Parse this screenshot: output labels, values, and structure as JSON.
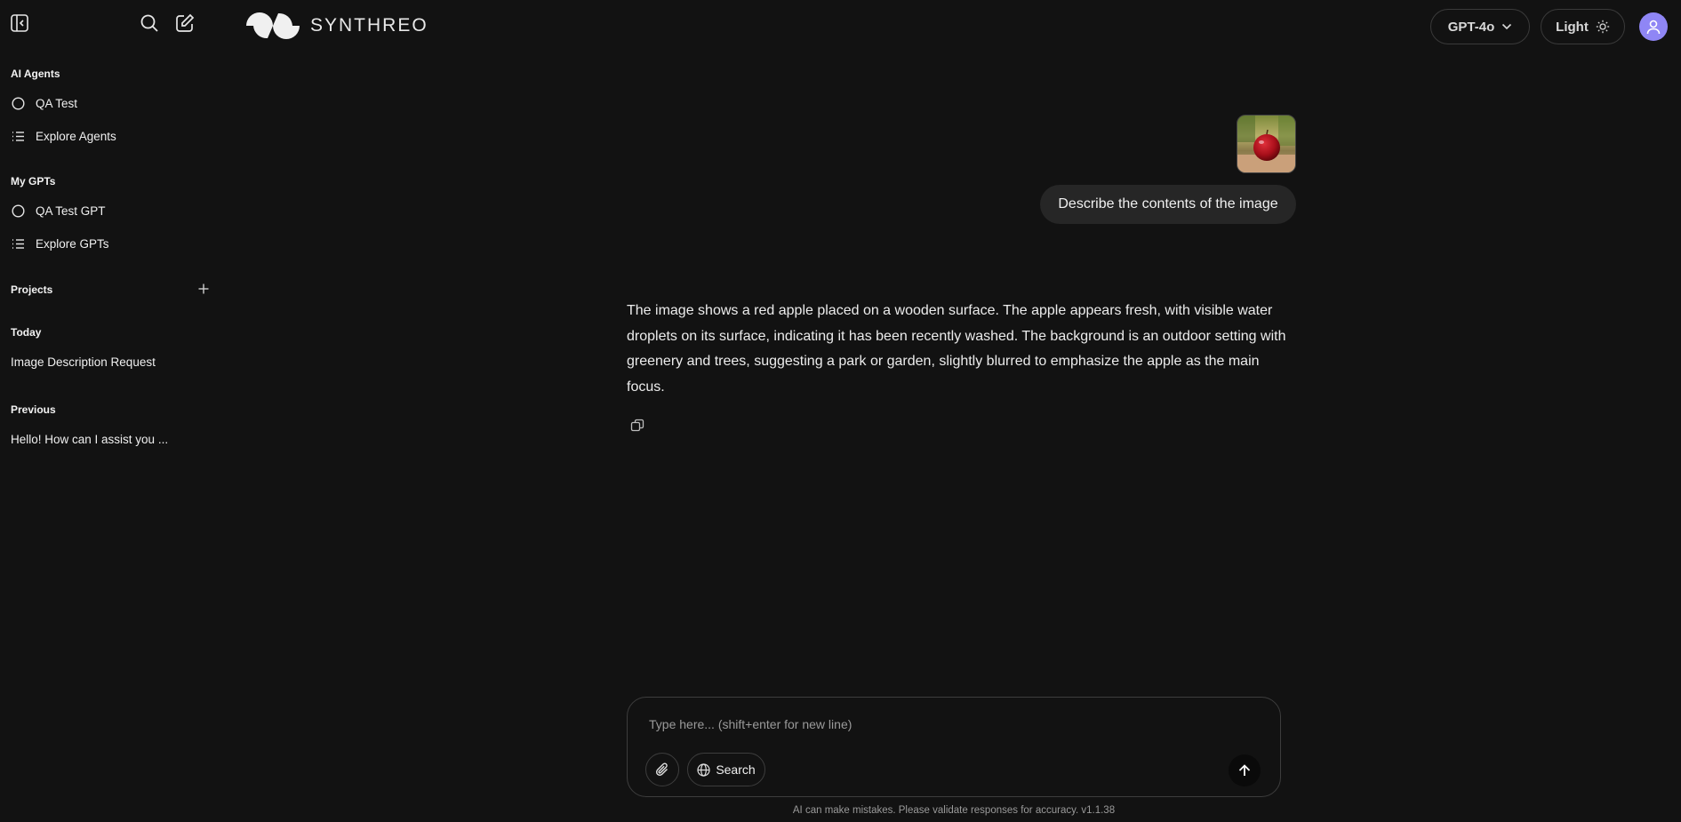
{
  "app": {
    "logo_text": "SYNTHREO"
  },
  "header": {
    "model_label": "GPT-4o",
    "theme_label": "Light"
  },
  "sidebar": {
    "agents": {
      "title": "AI Agents",
      "items": [
        {
          "label": "QA Test"
        },
        {
          "label": "Explore Agents"
        }
      ]
    },
    "gpts": {
      "title": "My GPTs",
      "items": [
        {
          "label": "QA Test GPT"
        },
        {
          "label": "Explore GPTs"
        }
      ]
    },
    "projects": {
      "title": "Projects"
    },
    "today": {
      "title": "Today",
      "items": [
        {
          "label": "Image Description Request"
        }
      ]
    },
    "previous": {
      "title": "Previous",
      "items": [
        {
          "label": "Hello! How can I assist you ..."
        }
      ]
    }
  },
  "chat": {
    "user_message": "Describe the contents of the image",
    "assistant_message": "The image shows a red apple placed on a wooden surface. The apple appears fresh, with visible water droplets on its surface, indicating it has been recently washed. The background is an outdoor setting with greenery and trees, suggesting a park or garden, slightly blurred to emphasize the apple as the main focus."
  },
  "composer": {
    "placeholder": "Type here... (shift+enter for new line)",
    "search_label": "Search",
    "disclaimer": "AI can make mistakes. Please validate responses for accuracy. v1.1.38"
  },
  "colors": {
    "background": "#121212",
    "avatar": "#8f86f5",
    "user_bubble": "#262626"
  },
  "icons": {
    "sidebar_toggle": "sidebar-toggle-icon",
    "search": "search-icon",
    "new_chat": "edit-icon",
    "agent": "circle-icon",
    "explore": "list-icon",
    "add_project": "plus-icon",
    "model_dropdown": "chevron-down-icon",
    "theme": "sun-icon",
    "user": "user-icon",
    "copy": "copy-icon",
    "attach": "paperclip-icon",
    "web": "globe-icon",
    "send": "arrow-up-icon"
  }
}
